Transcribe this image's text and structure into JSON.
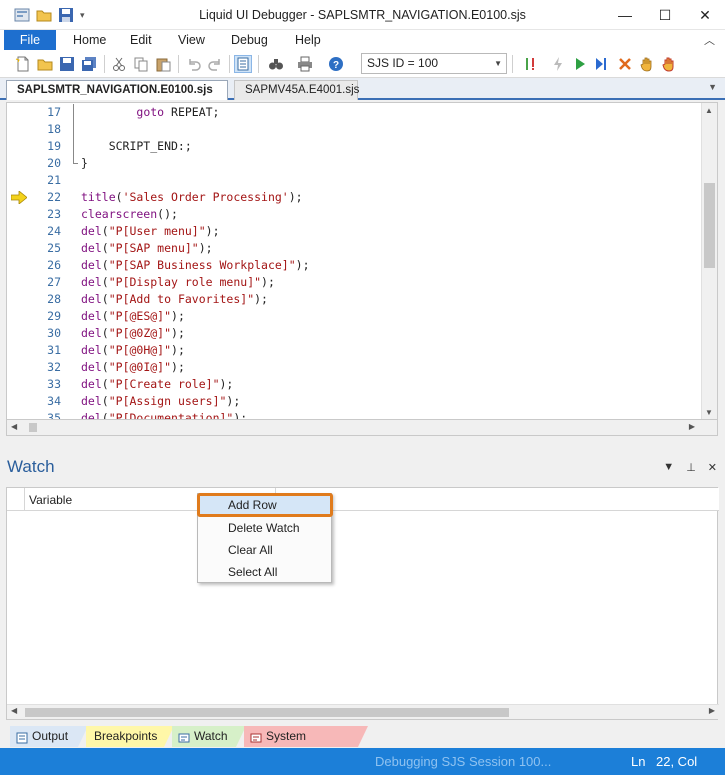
{
  "window": {
    "title": "Liquid UI Debugger - SAPLSMTR_NAVIGATION.E0100.sjs",
    "controls": [
      "minimize-icon",
      "maximize-icon",
      "close-icon"
    ]
  },
  "menubar": {
    "file": "File",
    "items": [
      "Home",
      "Edit",
      "View",
      "Debug",
      "Help"
    ]
  },
  "toolbar": {
    "sjs_select_value": "SJS ID = 100",
    "icons": [
      "new-file-icon",
      "open-folder-icon",
      "save-icon",
      "save-all-icon",
      "cut-icon",
      "copy-icon",
      "paste-icon",
      "undo-icon",
      "redo-icon",
      "document-view-icon",
      "find-icon",
      "print-icon",
      "help-icon",
      "breakpoint-icon",
      "step-icon",
      "run-icon",
      "step-into-icon",
      "stop-icon",
      "hand-icon",
      "hand-all-icon"
    ]
  },
  "tabs": [
    {
      "label": "SAPLSMTR_NAVIGATION.E0100.sjs",
      "active": true
    },
    {
      "label": "SAPMV45A.E4001.sjs",
      "active": false
    }
  ],
  "editor": {
    "current_line": 22,
    "lines": [
      {
        "num": "17",
        "text": "        goto REPEAT;"
      },
      {
        "num": "18",
        "text": ""
      },
      {
        "num": "19",
        "text": "    SCRIPT_END:;"
      },
      {
        "num": "20",
        "text": "}"
      },
      {
        "num": "21",
        "text": ""
      },
      {
        "num": "22",
        "text": "title('Sales Order Processing');"
      },
      {
        "num": "23",
        "text": "clearscreen();"
      },
      {
        "num": "24",
        "text": "del(\"P[User menu]\");"
      },
      {
        "num": "25",
        "text": "del(\"P[SAP menu]\");"
      },
      {
        "num": "26",
        "text": "del(\"P[SAP Business Workplace]\");"
      },
      {
        "num": "27",
        "text": "del(\"P[Display role menu]\");"
      },
      {
        "num": "28",
        "text": "del(\"P[Add to Favorites]\");"
      },
      {
        "num": "29",
        "text": "del(\"P[@ES@]\");"
      },
      {
        "num": "30",
        "text": "del(\"P[@0Z@]\");"
      },
      {
        "num": "31",
        "text": "del(\"P[@0H@]\");"
      },
      {
        "num": "32",
        "text": "del(\"P[@0I@]\");"
      },
      {
        "num": "33",
        "text": "del(\"P[Create role]\");"
      },
      {
        "num": "34",
        "text": "del(\"P[Assign users]\");"
      },
      {
        "num": "35",
        "text": "del(\"P[Documentation]\");"
      }
    ]
  },
  "watch": {
    "title": "Watch",
    "column_variable": "Variable",
    "context_menu": [
      "Add Row",
      "Delete Watch",
      "Clear All",
      "Select All"
    ],
    "highlighted_item": "Add Row"
  },
  "bottom_tabs": [
    {
      "label": "Output",
      "color": "#dbe7f5"
    },
    {
      "label": "Breakpoints",
      "color": "#fff7a8"
    },
    {
      "label": "Watch",
      "color": "#d6f0c8"
    },
    {
      "label": "System Variables",
      "color": "#f7b8b8"
    }
  ],
  "status": {
    "message": "Debugging SJS Session 100...",
    "ln_label": "Ln",
    "ln_value": "22, Col"
  },
  "colors": {
    "accent": "#1e6fcf",
    "status_bar": "#1c7fd8",
    "highlight_border": "#e07b1c",
    "line_number": "#3a6da3",
    "keyword": "#7f0f7f",
    "string": "#a31515"
  }
}
